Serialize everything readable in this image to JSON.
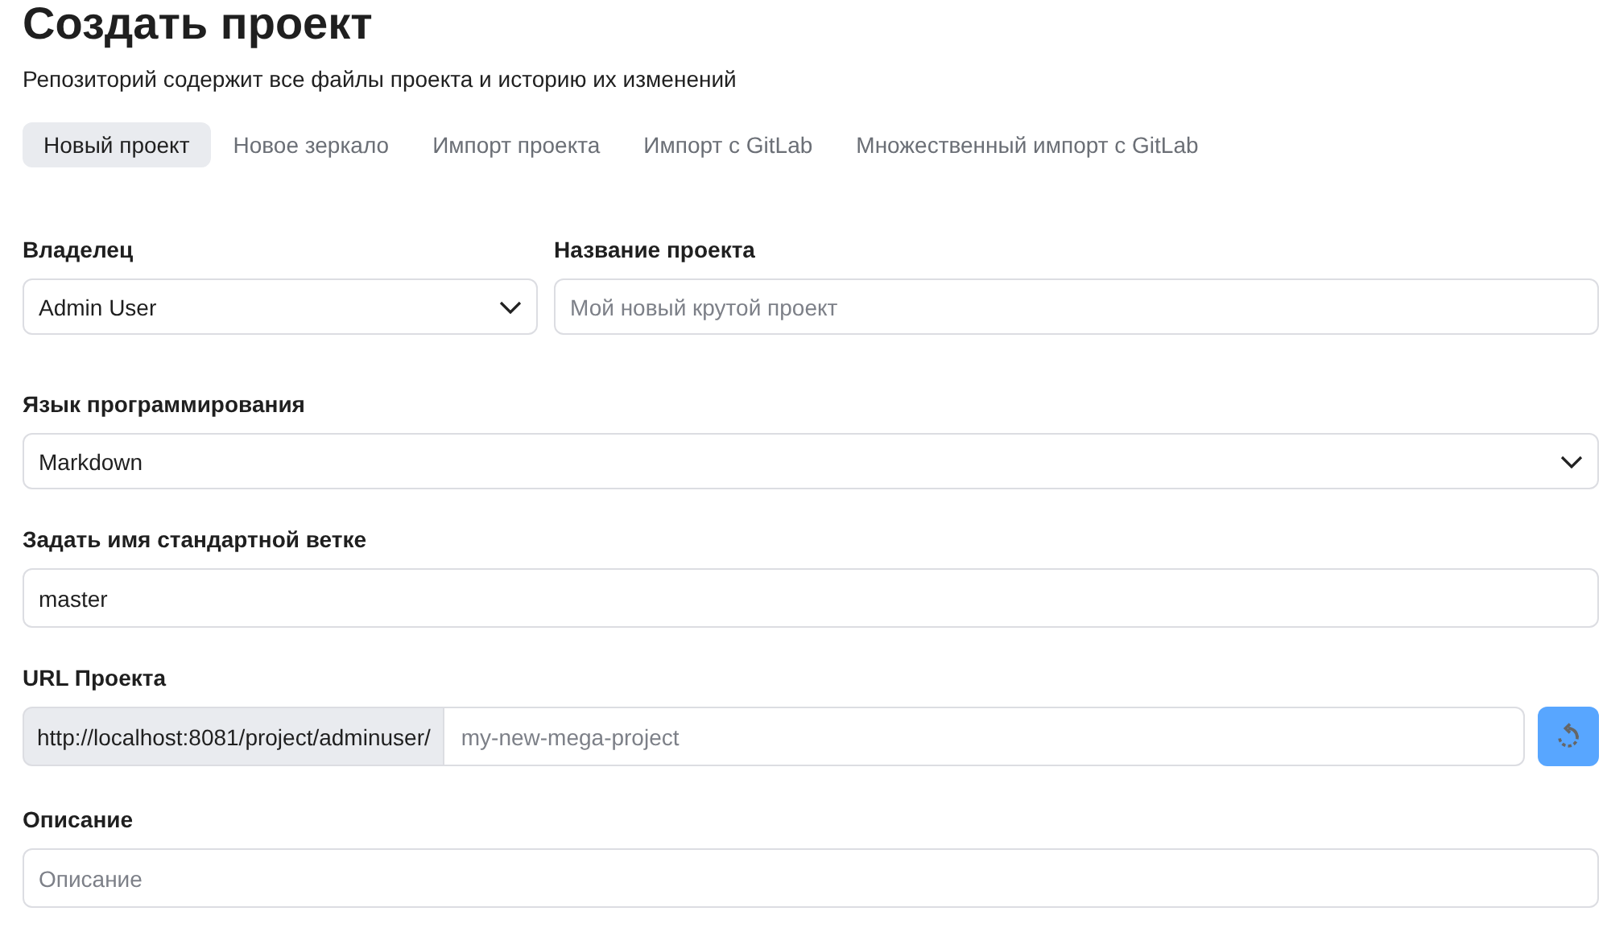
{
  "title": "Создать проект",
  "subtitle": "Репозиторий содержит все файлы проекта и историю их изменений",
  "tabs": [
    {
      "label": "Новый проект",
      "selected": true
    },
    {
      "label": "Новое зеркало",
      "selected": false
    },
    {
      "label": "Импорт проекта",
      "selected": false
    },
    {
      "label": "Импорт с GitLab",
      "selected": false
    },
    {
      "label": "Множественный импорт с GitLab",
      "selected": false
    }
  ],
  "owner": {
    "label": "Владелец",
    "value": "Admin User"
  },
  "project_name": {
    "label": "Название проекта",
    "placeholder": "Мой новый крутой проект"
  },
  "language": {
    "label": "Язык программирования",
    "value": "Markdown"
  },
  "default_branch": {
    "label": "Задать имя стандартной ветке",
    "value": "master"
  },
  "project_url": {
    "label": "URL Проекта",
    "prefix": "http://localhost:8081/project/adminuser/",
    "placeholder": "my-new-mega-project"
  },
  "description": {
    "label": "Описание",
    "placeholder": "Описание"
  }
}
